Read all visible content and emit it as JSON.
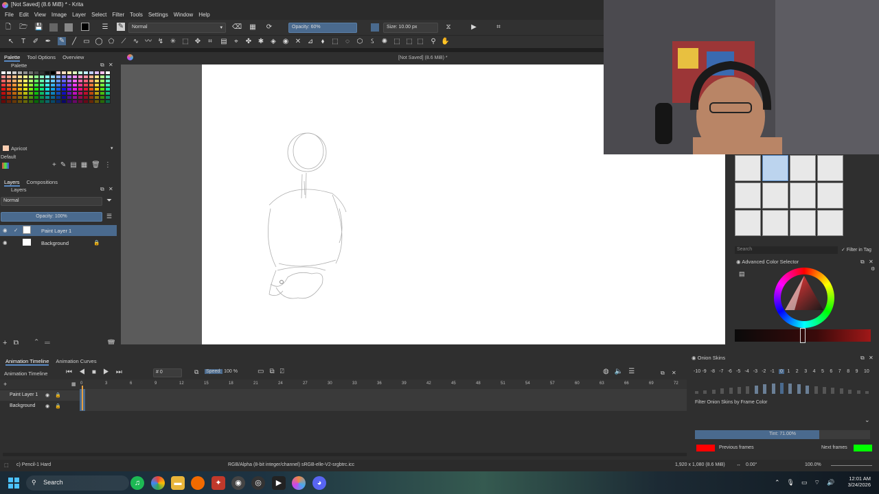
{
  "window": {
    "title": "[Not Saved]  (8.6 MiB) * - Krita"
  },
  "menu": [
    "File",
    "Edit",
    "View",
    "Image",
    "Layer",
    "Select",
    "Filter",
    "Tools",
    "Settings",
    "Window",
    "Help"
  ],
  "toolbar": {
    "blend_mode": "Normal",
    "opacity": "Opacity: 60%",
    "size": "Size: 10.00 px"
  },
  "left_tabs": [
    "Palette",
    "Tool Options",
    "Overview"
  ],
  "palette": {
    "title": "Palette",
    "current_color_name": "Apricot",
    "preset": "Default"
  },
  "layers_tabs": [
    "Layers",
    "Compositions"
  ],
  "layers": {
    "title": "Layers",
    "blend_mode": "Normal",
    "opacity": "Opacity: 100%",
    "items": [
      {
        "name": "Paint Layer 1",
        "selected": true
      },
      {
        "name": "Background",
        "selected": false
      }
    ]
  },
  "canvas": {
    "doc_title": "[Not Saved]  (8.6 MiB) *"
  },
  "brush_presets": {
    "search_placeholder": "Search",
    "filter_label": "Filter in Tag"
  },
  "color_selector": {
    "title": "Advanced Color Selector"
  },
  "timeline": {
    "tabs": [
      "Animation Timeline",
      "Animation Curves"
    ],
    "title": "Animation Timeline",
    "frame": "0",
    "speed_label": "Speed:",
    "speed_value": "100 %",
    "ticks": [
      "0",
      "3",
      "6",
      "9",
      "12",
      "15",
      "18",
      "21",
      "24",
      "27",
      "30",
      "33",
      "36",
      "39",
      "42",
      "45",
      "48",
      "51",
      "54",
      "57",
      "60",
      "63",
      "66",
      "69",
      "72"
    ],
    "rows": [
      "Paint Layer 1",
      "Background"
    ]
  },
  "onion": {
    "title": "Onion Skins",
    "numbers": [
      "-10",
      "-9",
      "-8",
      "-7",
      "-6",
      "-5",
      "-4",
      "-3",
      "-2",
      "-1",
      "0",
      "1",
      "2",
      "3",
      "4",
      "5",
      "6",
      "7",
      "8",
      "9",
      "10"
    ],
    "filter_label": "Filter Onion Skins by Frame Color",
    "tint": "Tint: 71.00%",
    "tint_fraction": 0.71,
    "previous_label": "Previous frames",
    "next_label": "Next frames",
    "previous_color": "#ff0000",
    "next_color": "#00ff00"
  },
  "status": {
    "brush": "c) Pencil-1 Hard",
    "color_space": "RGB/Alpha (8-bit integer/channel)  sRGB-elle-V2-srgbtrc.icc",
    "dimensions": "1,920 x 1,080 (8.6 MiB)",
    "rotation": "0.00°",
    "zoom": "100.0%"
  },
  "taskbar": {
    "search": "Search",
    "time": "12:01 AM",
    "date": "3/24/2026"
  }
}
